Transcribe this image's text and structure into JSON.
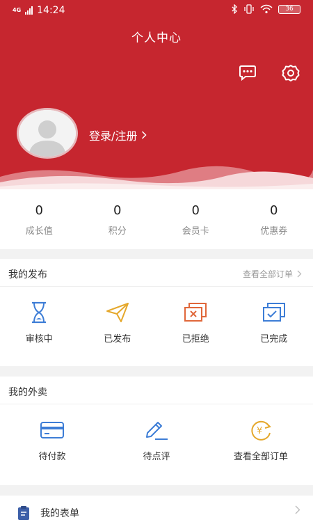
{
  "status_bar": {
    "network": "4G",
    "time": "14:24",
    "battery": "36"
  },
  "header": {
    "title": "个人中心",
    "login_label": "登录/注册"
  },
  "icons": {
    "message": "message-icon",
    "settings": "gear-icon",
    "avatar": "user-avatar-icon"
  },
  "stats": [
    {
      "value": "0",
      "label": "成长值"
    },
    {
      "value": "0",
      "label": "积分"
    },
    {
      "value": "0",
      "label": "会员卡"
    },
    {
      "value": "0",
      "label": "优惠券"
    }
  ],
  "my_posts": {
    "title": "我的发布",
    "link": "查看全部订单",
    "items": [
      {
        "label": "审核中",
        "icon": "hourglass-icon"
      },
      {
        "label": "已发布",
        "icon": "paper-plane-icon"
      },
      {
        "label": "已拒绝",
        "icon": "rejected-doc-icon"
      },
      {
        "label": "已完成",
        "icon": "completed-doc-icon"
      }
    ]
  },
  "my_takeout": {
    "title": "我的外卖",
    "items": [
      {
        "label": "待付款",
        "icon": "credit-card-icon"
      },
      {
        "label": "待点评",
        "icon": "pencil-icon"
      },
      {
        "label": "查看全部订单",
        "icon": "yuan-refresh-icon"
      }
    ]
  },
  "my_forms": {
    "label": "我的表单",
    "icon": "clipboard-icon"
  },
  "colors": {
    "brand": "#c6262f",
    "blue": "#3d7dd6",
    "gold": "#e5a82c",
    "orange": "#e0673a"
  }
}
